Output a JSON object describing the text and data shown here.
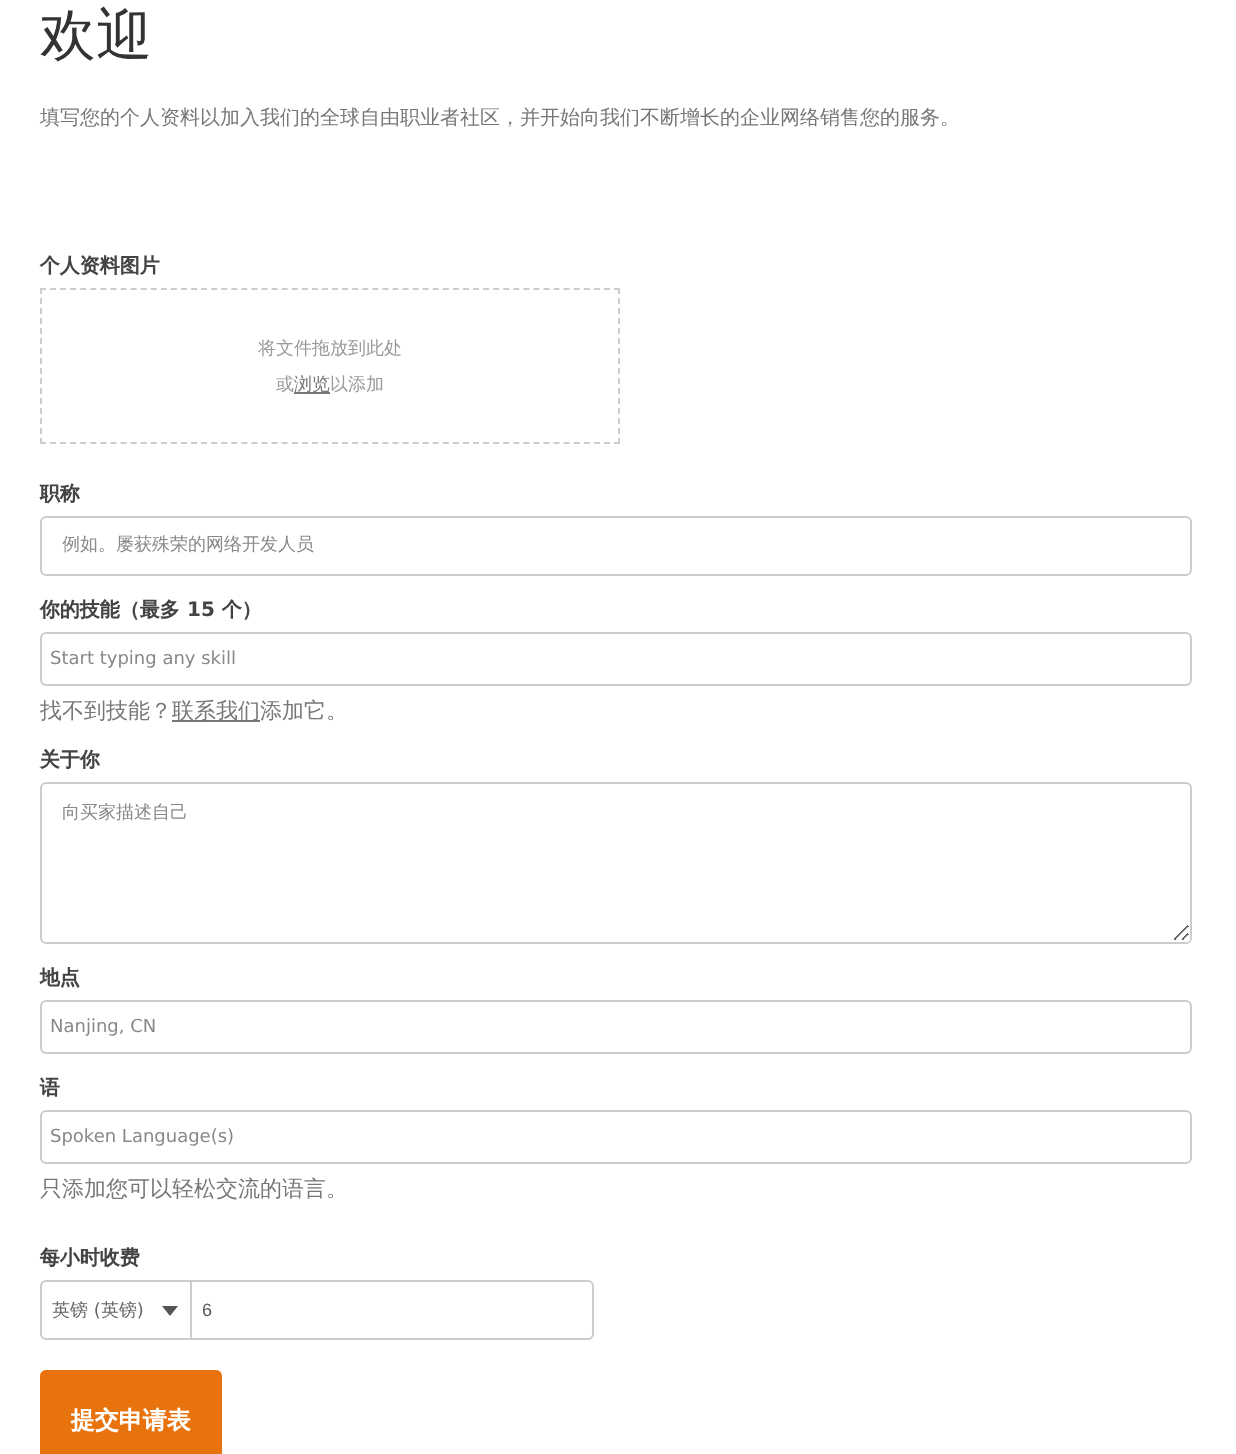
{
  "title": "欢迎",
  "intro": "填写您的个人资料以加入我们的全球自由职业者社区，并开始向我们不断增长的企业网络销售您的服务。",
  "photo": {
    "label": "个人资料图片",
    "drop_text": "将文件拖放到此处",
    "browse_prefix": "或",
    "browse_link": "浏览",
    "browse_suffix": "以添加"
  },
  "fields": [
    {
      "kind": "input",
      "label": "职称",
      "placeholder": "例如。屡获殊荣的网络开发人员"
    },
    {
      "kind": "input",
      "label": "你的技能（最多 15 个）",
      "placeholder": "Start typing any skill",
      "help_prefix": "找不到技能？",
      "help_link": "联系我们",
      "help_suffix": "添加它。"
    },
    {
      "kind": "textarea",
      "label": "关于你",
      "placeholder": "向买家描述自己"
    },
    {
      "kind": "input",
      "label": "地点",
      "placeholder": "Nanjing, CN"
    },
    {
      "kind": "input",
      "label": "语",
      "placeholder": "Spoken Language(s)",
      "help_prefix": "只添加您可以轻松交流的语言。"
    }
  ],
  "rate": {
    "label": "每小时收费",
    "currency": "英镑 (英镑)",
    "value": "6"
  },
  "submit": "提交申请表"
}
